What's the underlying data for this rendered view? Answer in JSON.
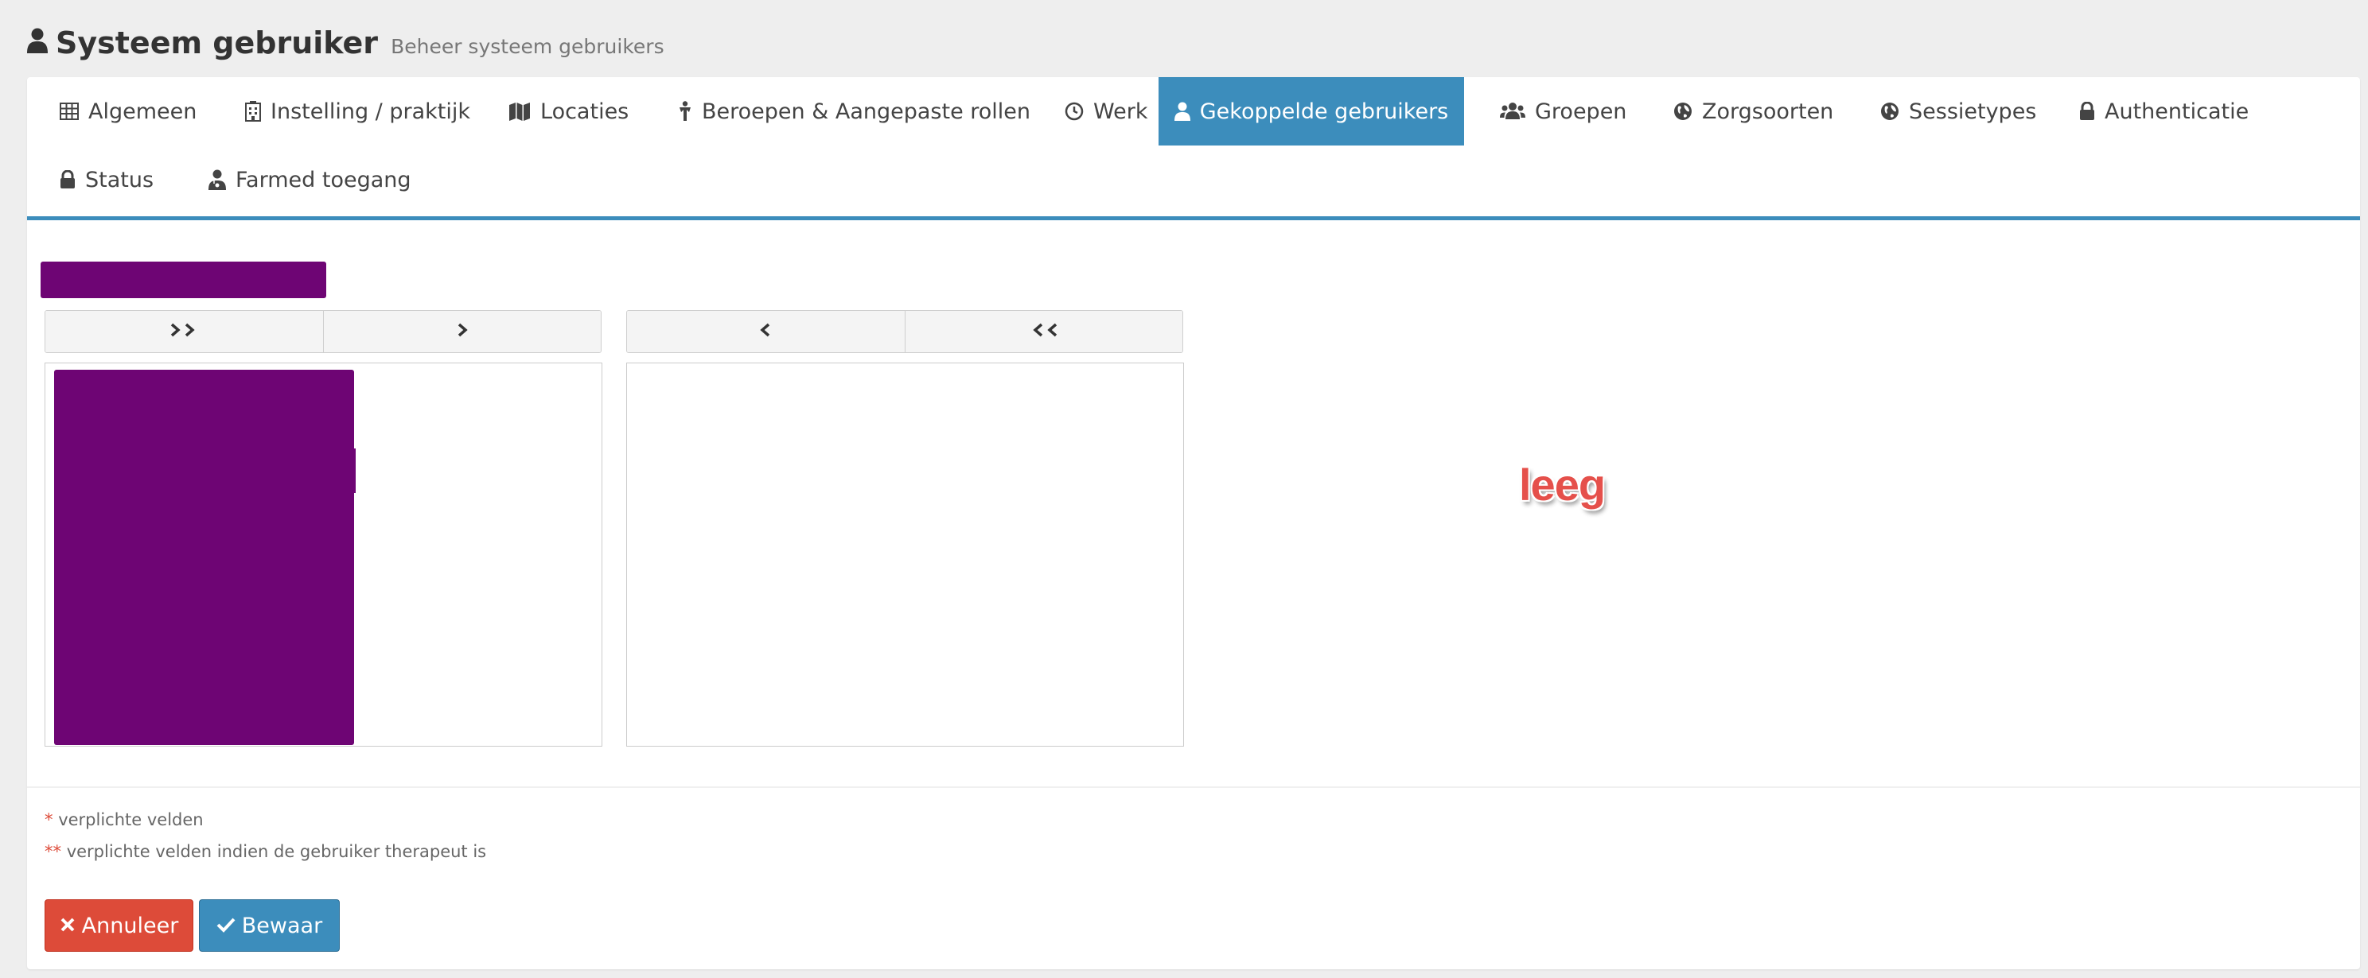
{
  "header": {
    "title": "Systeem gebruiker",
    "subtitle": "Beheer systeem gebruikers"
  },
  "tabs": [
    {
      "label": "Algemeen",
      "icon": "table-icon",
      "active": false
    },
    {
      "label": "Instelling / praktijk",
      "icon": "building-icon",
      "active": false
    },
    {
      "label": "Locaties",
      "icon": "map-icon",
      "active": false
    },
    {
      "label": "Beroepen & Aangepaste rollen",
      "icon": "person-icon",
      "active": false
    },
    {
      "label": "Werk",
      "icon": "clock-icon",
      "active": false
    },
    {
      "label": "Gekoppelde gebruikers",
      "icon": "user-icon",
      "active": true
    },
    {
      "label": "Groepen",
      "icon": "users-icon",
      "active": false
    },
    {
      "label": "Zorgsoorten",
      "icon": "globe-icon",
      "active": false
    },
    {
      "label": "Sessietypes",
      "icon": "globe-icon",
      "active": false
    },
    {
      "label": "Authenticatie",
      "icon": "lock-icon",
      "active": false
    },
    {
      "label": "Status",
      "icon": "lock-icon",
      "active": false
    },
    {
      "label": "Farmed toegang",
      "icon": "user-md-icon",
      "active": false
    }
  ],
  "duallist": {
    "empty_text": "leeg"
  },
  "notes": {
    "required_marker": "*",
    "required_text": "verplichte velden",
    "therapist_marker": "**",
    "therapist_text": "verplichte velden indien de gebruiker therapeut is"
  },
  "buttons": {
    "cancel": "Annuleer",
    "save": "Bewaar"
  },
  "colors": {
    "accent": "#3c8dbc",
    "danger": "#dd4b39",
    "redacted": "#6e0574"
  }
}
